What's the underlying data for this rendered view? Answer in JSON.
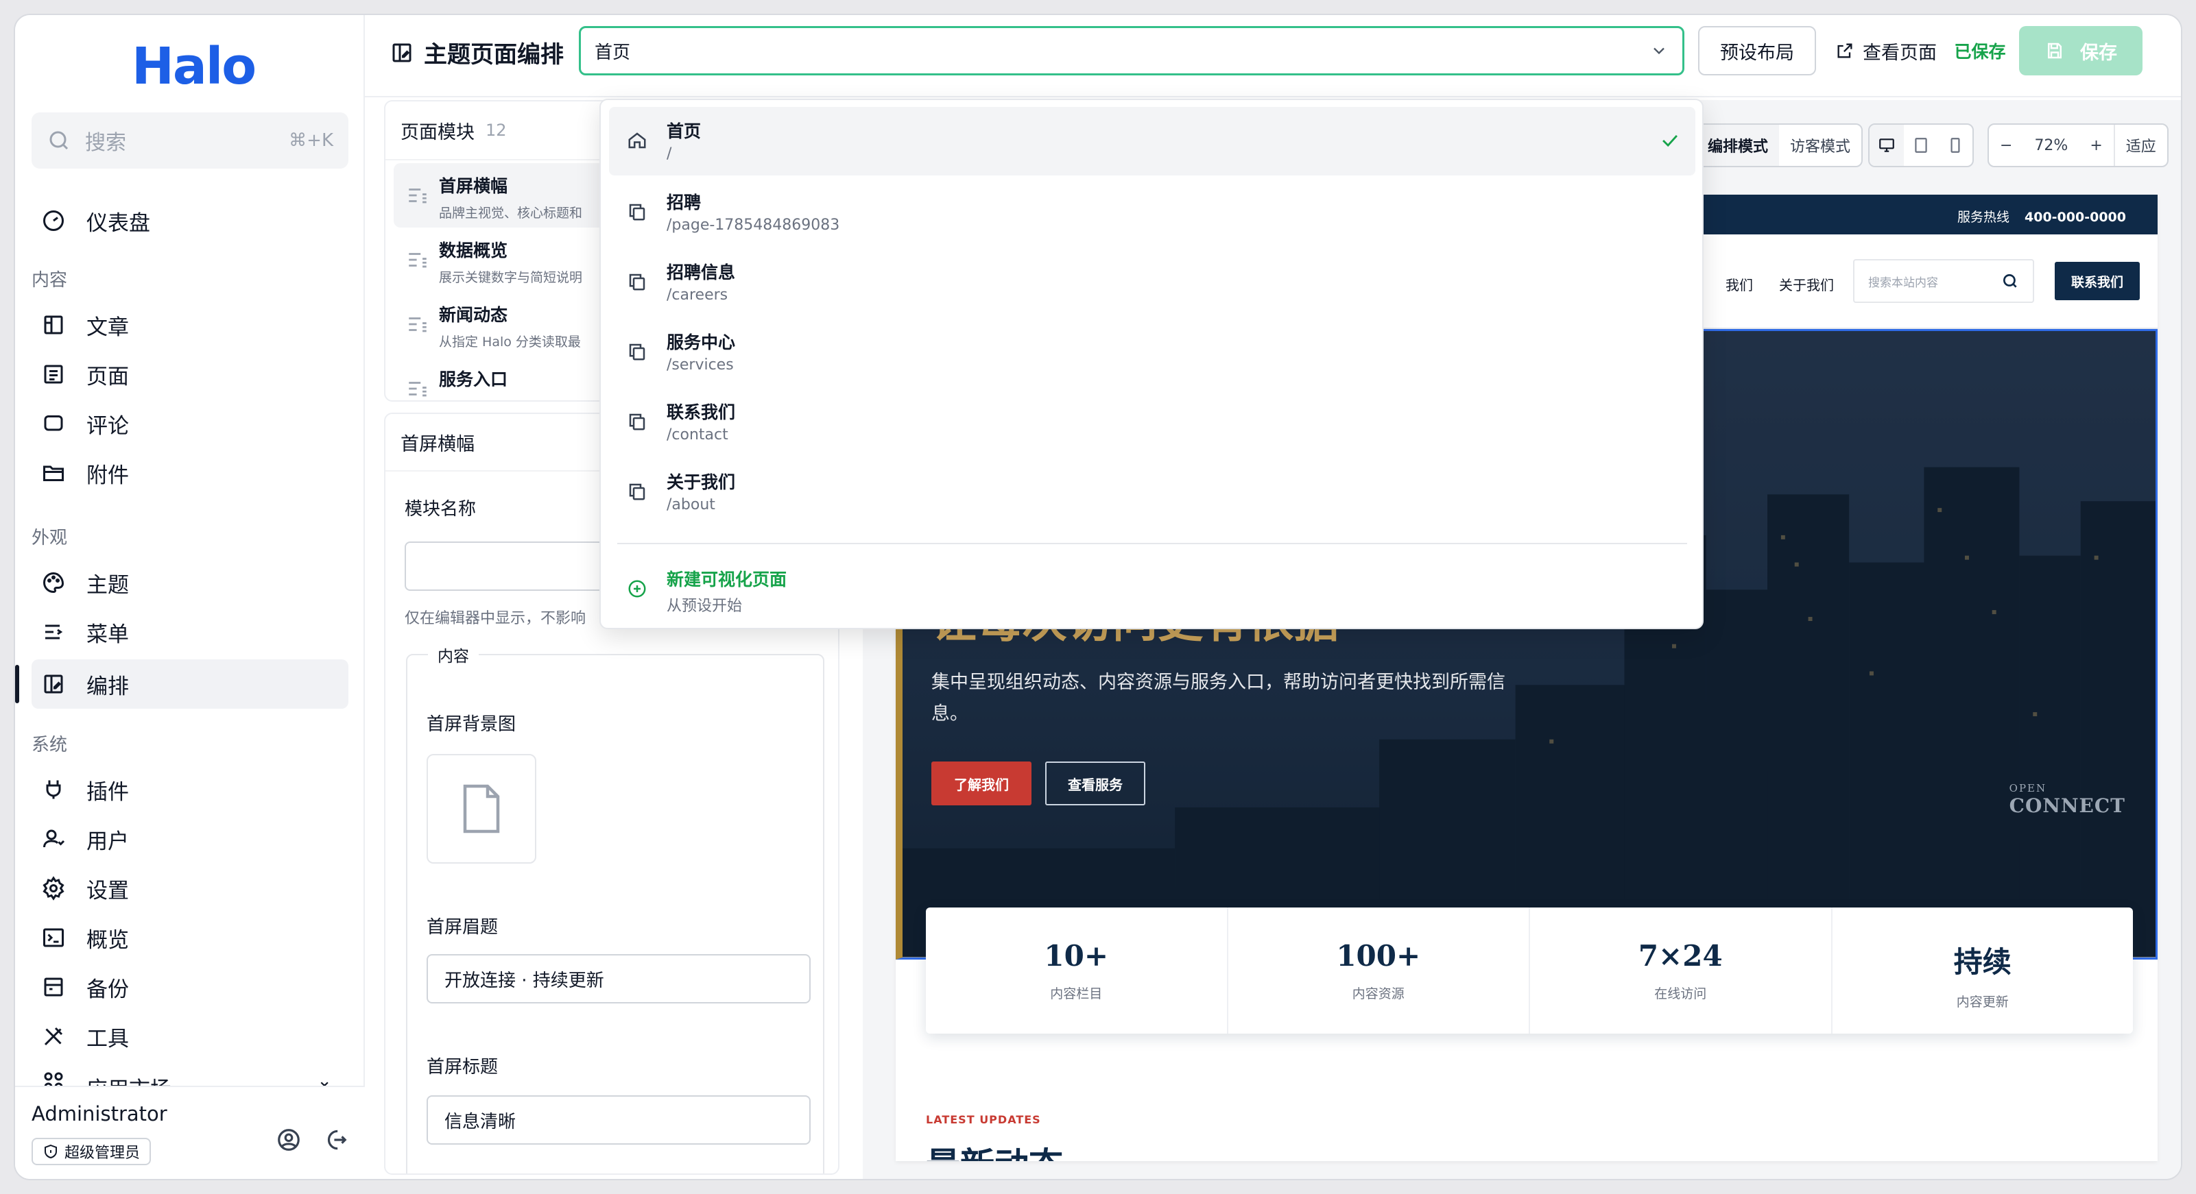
{
  "app": {
    "logo": "Halo",
    "search_placeholder": "搜索",
    "search_shortcut": "⌘+K"
  },
  "sidebar": {
    "top_items": [
      {
        "label": "仪表盘",
        "icon": "dashboard-icon"
      }
    ],
    "groups": [
      {
        "title": "内容",
        "items": [
          {
            "label": "文章",
            "icon": "post-icon"
          },
          {
            "label": "页面",
            "icon": "page-icon"
          },
          {
            "label": "评论",
            "icon": "comment-icon"
          },
          {
            "label": "附件",
            "icon": "folder-icon"
          }
        ]
      },
      {
        "title": "外观",
        "items": [
          {
            "label": "主题",
            "icon": "palette-icon"
          },
          {
            "label": "菜单",
            "icon": "menu-icon"
          },
          {
            "label": "编排",
            "icon": "layout-icon",
            "active": true
          }
        ]
      },
      {
        "title": "系统",
        "items": [
          {
            "label": "插件",
            "icon": "plug-icon"
          },
          {
            "label": "用户",
            "icon": "user-icon"
          },
          {
            "label": "设置",
            "icon": "gear-icon"
          },
          {
            "label": "概览",
            "icon": "terminal-icon"
          },
          {
            "label": "备份",
            "icon": "backup-icon"
          },
          {
            "label": "工具",
            "icon": "tools-icon"
          },
          {
            "label": "应用市场",
            "icon": "apps-icon"
          }
        ]
      }
    ],
    "user": {
      "name": "Administrator",
      "role": "超级管理员"
    }
  },
  "topbar": {
    "title": "主题页面编排",
    "selected_page": "首页",
    "preset_label": "预设布局",
    "view_page_label": "查看页面",
    "saved_status": "已保存",
    "save_label": "保存"
  },
  "modules_panel": {
    "title": "页面模块",
    "count": "12",
    "items": [
      {
        "title": "首屏横幅",
        "desc": "品牌主视觉、核心标题和"
      },
      {
        "title": "数据概览",
        "desc": "展示关键数字与简短说明"
      },
      {
        "title": "新闻动态",
        "desc": "从指定 Halo 分类读取最"
      },
      {
        "title": "服务入口",
        "desc": ""
      }
    ]
  },
  "form_panel": {
    "title": "首屏横幅",
    "module_name_label": "模块名称",
    "module_name_value": "",
    "module_name_help": "仅在编辑器中显示，不影响",
    "content_legend": "内容",
    "bg_label": "首屏背景图",
    "eyebrow_label": "首屏眉题",
    "eyebrow_value": "开放连接 · 持续更新",
    "heading_label": "首屏标题",
    "heading_value": "信息清晰"
  },
  "canvas_toolbar": {
    "mode_edit": "编排模式",
    "mode_visitor": "访客模式",
    "zoom": "72%",
    "fit": "适应",
    "zoom_out": "−",
    "zoom_in": "+"
  },
  "preview": {
    "hotline_label": "服务热线",
    "hotline_number": "400-000-0000",
    "nav_links": [
      "联系我们",
      "关于我们"
    ],
    "nav_link_first_visible": "我们",
    "search_placeholder": "搜索本站内容",
    "contact_button": "联系我们",
    "hero_title_partial": "让每次访问更有依据",
    "hero_subtitle": "集中呈现组织动态、内容资源与服务入口，帮助访问者更快找到所需信息。",
    "hero_btn_primary": "了解我们",
    "hero_btn_secondary": "查看服务",
    "sign_open": "OPEN",
    "sign_connect": "CONNECT",
    "stats": [
      {
        "value": "10+",
        "label": "内容栏目"
      },
      {
        "value": "100+",
        "label": "内容资源"
      },
      {
        "value": "7×24",
        "label": "在线访问"
      },
      {
        "value": "持续",
        "label": "内容更新"
      }
    ],
    "latest_eyebrow": "LATEST UPDATES",
    "latest_title": "最新动态"
  },
  "dropdown": {
    "items": [
      {
        "title": "首页",
        "path": "/",
        "icon": "home-icon",
        "selected": true
      },
      {
        "title": "招聘",
        "path": "/page-1785484869083",
        "icon": "copy-icon"
      },
      {
        "title": "招聘信息",
        "path": "/careers",
        "icon": "copy-icon"
      },
      {
        "title": "服务中心",
        "path": "/services",
        "icon": "copy-icon"
      },
      {
        "title": "联系我们",
        "path": "/contact",
        "icon": "copy-icon"
      },
      {
        "title": "关于我们",
        "path": "/about",
        "icon": "copy-icon"
      }
    ],
    "new_page": {
      "title": "新建可视化页面",
      "subtitle": "从预设开始"
    }
  },
  "colors": {
    "brand": "#1d5fe6",
    "accent_green": "#16a34a",
    "site_navy": "#0f2a48",
    "site_red": "#c83a32",
    "site_gold": "#c9a25a"
  }
}
